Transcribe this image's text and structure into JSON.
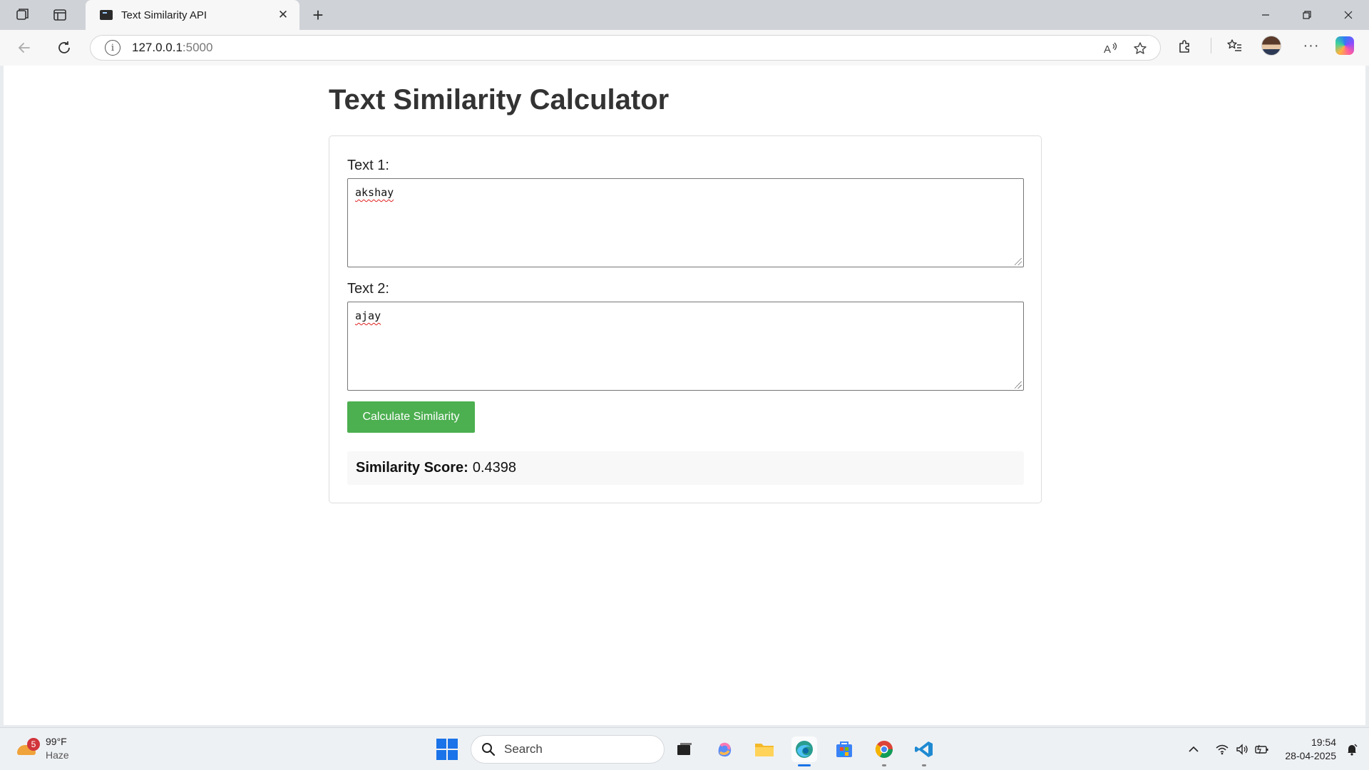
{
  "browser": {
    "tab_title": "Text Similarity API",
    "url_host": "127.0.0.1",
    "url_port": ":5000"
  },
  "page": {
    "title": "Text Similarity Calculator",
    "text1_label": "Text 1:",
    "text1_value": "akshay",
    "text2_label": "Text 2:",
    "text2_value": "ajay",
    "button_label": "Calculate Similarity",
    "result_label": "Similarity Score:",
    "result_value": "0.4398"
  },
  "taskbar": {
    "weather_temp": "99°F",
    "weather_condition": "Haze",
    "weather_badge": "5",
    "search_placeholder": "Search",
    "time": "19:54",
    "date": "28-04-2025"
  },
  "colors": {
    "button_bg": "#4caf50",
    "title_text": "#333333",
    "result_bg": "#f8f8f8"
  },
  "icons": {
    "workspaces": "workspaces-icon",
    "tab_actions": "tab-actions-icon",
    "back": "back-arrow-icon",
    "refresh": "refresh-icon",
    "site_info": "info-icon",
    "read_aloud": "read-aloud-icon",
    "favorite": "star-icon",
    "extensions": "puzzle-icon",
    "favorites_bar": "favorites-icon",
    "more": "more-icon",
    "copilot": "copilot-icon"
  }
}
